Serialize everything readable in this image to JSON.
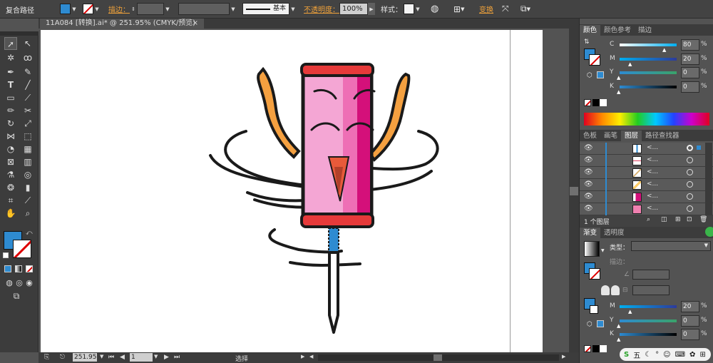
{
  "control_bar": {
    "selection_label": "复合路径",
    "stroke_label": "描边：",
    "stroke_profile": "基本",
    "opacity_label": "不透明度：",
    "opacity_value": "100%",
    "style_label": "样式：",
    "transform_label": "变换",
    "fill_color": "#2e8bd1",
    "icons": [
      "fill-swatch-icon",
      "stroke-none-icon",
      "recolor-icon",
      "align-icon",
      "transform-icon",
      "menu-icon"
    ]
  },
  "document_tab": {
    "title": "11A084 [转换].ai* @ 251.95% (CMYK/预览)",
    "close": "×"
  },
  "status_bar": {
    "zoom": "251.95",
    "artboard_number": "1",
    "tool_status": "选择"
  },
  "color_panel": {
    "tabs": [
      "颜色",
      "颜色参考",
      "描边"
    ],
    "active_tab": "颜色",
    "channels": [
      {
        "label": "C",
        "value": "80",
        "unit": "%",
        "fraction": 0.8
      },
      {
        "label": "M",
        "value": "20",
        "unit": "%",
        "fraction": 0.2
      },
      {
        "label": "Y",
        "value": "0",
        "unit": "%",
        "fraction": 0.0
      },
      {
        "label": "K",
        "value": "0",
        "unit": "%",
        "fraction": 0.0
      }
    ]
  },
  "layers_panel": {
    "tabs": [
      "色板",
      "画笔",
      "图层",
      "路径查找器"
    ],
    "active_tab": "图层",
    "rows": [
      {
        "name": "<...",
        "thumb_color": "#2e8bd1"
      },
      {
        "name": "<...",
        "thumb_color": "#e04060"
      },
      {
        "name": "<...",
        "thumb_color": "#d8b070"
      },
      {
        "name": "<...",
        "thumb_color": "#ffcc66"
      },
      {
        "name": "<...",
        "thumb_color": "#d4107a"
      },
      {
        "name": "<...",
        "thumb_color": "#f080b0"
      }
    ],
    "footer": "1 个图层"
  },
  "gradient_panel": {
    "tabs": [
      "渐变",
      "透明度"
    ],
    "active_tab": "渐变",
    "type_label": "类型：",
    "stroke_label": "描边：",
    "channels": [
      {
        "label": "M",
        "value": "20",
        "unit": "%",
        "fraction": 0.2
      },
      {
        "label": "Y",
        "value": "0",
        "unit": "%",
        "fraction": 0.0
      },
      {
        "label": "K",
        "value": "0",
        "unit": "%",
        "fraction": 0.0
      }
    ]
  },
  "taskbar": {
    "ime_label": "五"
  }
}
